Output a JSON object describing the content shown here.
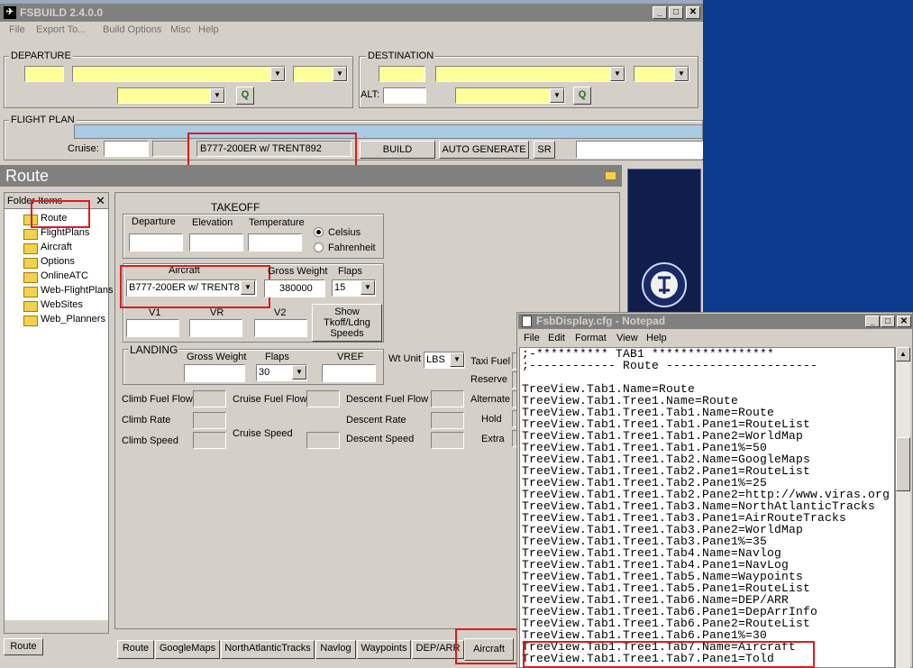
{
  "window": {
    "title": "FSBUILD 2.4.0.0"
  },
  "menu": [
    "File",
    "Export To...",
    "Build Options",
    "Misc",
    "Help"
  ],
  "departure": {
    "label": "DEPARTURE"
  },
  "destination": {
    "label": "DESTINATION",
    "alt_label": "ALT:"
  },
  "flight_plan": {
    "label": "FLIGHT PLAN",
    "cruise_label": "Cruise:",
    "aircraft_value": "B777-200ER w/ TRENT892",
    "build": "BUILD",
    "auto_generate": "AUTO GENERATE",
    "sr": "SR"
  },
  "route_header": "Route",
  "folder_panel": {
    "header": "Folder Items",
    "close": "✕",
    "items": [
      "Route",
      "FlightPlans",
      "Aircraft",
      "Options",
      "OnlineATC",
      "Web-FlightPlans",
      "WebSites",
      "Web_Planners"
    ],
    "tab": "Route"
  },
  "takeoff": {
    "title": "TAKEOFF",
    "departure": "Departure",
    "elevation": "Elevation",
    "temperature": "Temperature",
    "celsius": "Celsius",
    "fahrenheit": "Fahrenheit",
    "aircraft_label": "Aircraft",
    "aircraft_value": "B777-200ER w/ TRENT8",
    "gross_weight_label": "Gross Weight",
    "gross_weight_value": "380000",
    "flaps_label": "Flaps",
    "flaps_value": "15",
    "v1": "V1",
    "vr": "VR",
    "v2": "V2",
    "show_button": "Show Tkoff/Ldng Speeds"
  },
  "landing": {
    "title": "LANDING",
    "gross_weight_label": "Gross Weight",
    "flaps_label": "Flaps",
    "flaps_value": "30",
    "vref": "VREF",
    "wt_unit_label": "Wt Unit",
    "wt_unit_value": "LBS"
  },
  "fuel": {
    "climb_fuel_flow": "Climb Fuel Flow",
    "cruise_fuel_flow": "Cruise Fuel Flow",
    "descent_fuel_flow": "Descent Fuel Flow",
    "climb_rate": "Climb Rate",
    "descent_rate": "Descent Rate",
    "climb_speed": "Climb Speed",
    "cruise_speed": "Cruise Speed",
    "descent_speed": "Descent Speed",
    "taxi_fuel": "Taxi Fuel",
    "reserve": "Reserve",
    "alternate": "Alternate",
    "hold": "Hold",
    "extra": "Extra"
  },
  "bottom_tabs": [
    "Route",
    "GoogleMaps",
    "NorthAtlanticTracks",
    "Navlog",
    "Waypoints",
    "DEP/ARR",
    "Aircraft"
  ],
  "notepad": {
    "title": "FsbDisplay.cfg - Notepad",
    "menu": [
      "File",
      "Edit",
      "Format",
      "View",
      "Help"
    ],
    "lines": [
      ";-********** TAB1 *****************",
      ";------------ Route ---------------------",
      "",
      "TreeView.Tab1.Name=Route",
      "TreeView.Tab1.Tree1.Name=Route",
      "TreeView.Tab1.Tree1.Tab1.Name=Route",
      "TreeView.Tab1.Tree1.Tab1.Pane1=RouteList",
      "TreeView.Tab1.Tree1.Tab1.Pane2=WorldMap",
      "TreeView.Tab1.Tree1.Tab1.Pane1%=50",
      "TreeView.Tab1.Tree1.Tab2.Name=GoogleMaps",
      "TreeView.Tab1.Tree1.Tab2.Pane1=RouteList",
      "TreeView.Tab1.Tree1.Tab2.Pane1%=25",
      "TreeView.Tab1.Tree1.Tab2.Pane2=http://www.viras.org",
      "TreeView.Tab1.Tree1.Tab3.Name=NorthAtlanticTracks",
      "TreeView.Tab1.Tree1.Tab3.Pane1=AirRouteTracks",
      "TreeView.Tab1.Tree1.Tab3.Pane2=WorldMap",
      "TreeView.Tab1.Tree1.Tab3.Pane1%=35",
      "TreeView.Tab1.Tree1.Tab4.Name=Navlog",
      "TreeView.Tab1.Tree1.Tab4.Pane1=NavLog",
      "TreeView.Tab1.Tree1.Tab5.Name=Waypoints",
      "TreeView.Tab1.Tree1.Tab5.Pane1=RouteList",
      "TreeView.Tab1.Tree1.Tab6.Name=DEP/ARR",
      "TreeView.Tab1.Tree1.Tab6.Pane1=DepArrInfo",
      "TreeView.Tab1.Tree1.Tab6.Pane2=RouteList",
      "TreeView.Tab1.Tree1.Tab6.Pane1%=30",
      "TreeView.Tab1.Tree1.Tab7.Name=Aircraft",
      "TreeView.Tab1.Tree1.Tab7.Pane1=Told"
    ]
  }
}
